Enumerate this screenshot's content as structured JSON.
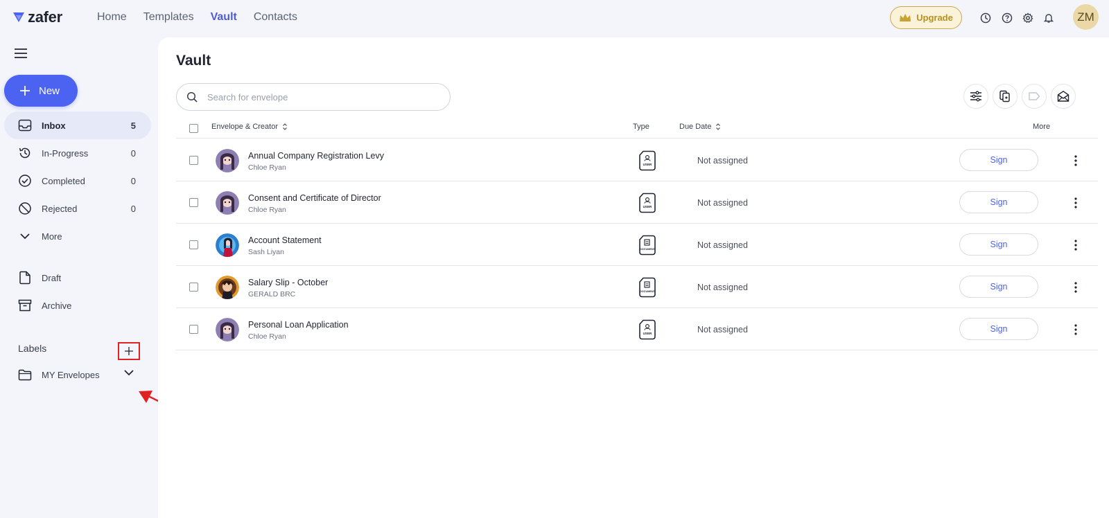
{
  "brand": {
    "name": "zafer"
  },
  "nav": [
    {
      "label": "Home"
    },
    {
      "label": "Templates"
    },
    {
      "label": "Vault"
    },
    {
      "label": "Contacts"
    }
  ],
  "header": {
    "upgrade_label": "Upgrade",
    "avatar_initials": "ZM"
  },
  "sidebar": {
    "new_label": "New",
    "items": [
      {
        "label": "Inbox",
        "count": "5",
        "icon": "inbox-icon"
      },
      {
        "label": "In-Progress",
        "count": "0",
        "icon": "history-icon"
      },
      {
        "label": "Completed",
        "count": "0",
        "icon": "check-circle-icon"
      },
      {
        "label": "Rejected",
        "count": "0",
        "icon": "ban-icon"
      },
      {
        "label": "More",
        "icon": "chevron-down-icon"
      },
      {
        "label": "Draft",
        "icon": "file-icon"
      },
      {
        "label": "Archive",
        "icon": "archive-icon"
      }
    ],
    "labels_title": "Labels",
    "label_items": [
      {
        "label": "MY Envelopes"
      }
    ]
  },
  "main": {
    "title": "Vault",
    "search": {
      "placeholder": "Search for envelope",
      "value": ""
    },
    "columns": {
      "envelope": "Envelope & Creator",
      "type": "Type",
      "due": "Due Date",
      "more": "More"
    },
    "rows": [
      {
        "title": "Annual Company Registration Levy",
        "creator": "Chloe Ryan",
        "type": "USER",
        "due": "Not assigned",
        "action": "Sign"
      },
      {
        "title": "Consent and Certificate of Director",
        "creator": "Chloe Ryan",
        "type": "USER",
        "due": "Not assigned",
        "action": "Sign"
      },
      {
        "title": "Account Statement",
        "creator": "Sash Liyan",
        "type": "DOCUMENT",
        "due": "Not assigned",
        "action": "Sign"
      },
      {
        "title": "Salary Slip - October",
        "creator": "GERALD BRC",
        "type": "DOCUMENT",
        "due": "Not assigned",
        "action": "Sign"
      },
      {
        "title": "Personal Loan Application",
        "creator": "Chloe Ryan",
        "type": "USER",
        "due": "Not assigned",
        "action": "Sign"
      }
    ]
  },
  "colors": {
    "accent": "#4b63f0",
    "nav_active": "#4f5bd5",
    "upgrade_gold": "#b8901e",
    "annotation_red": "#e02222"
  }
}
